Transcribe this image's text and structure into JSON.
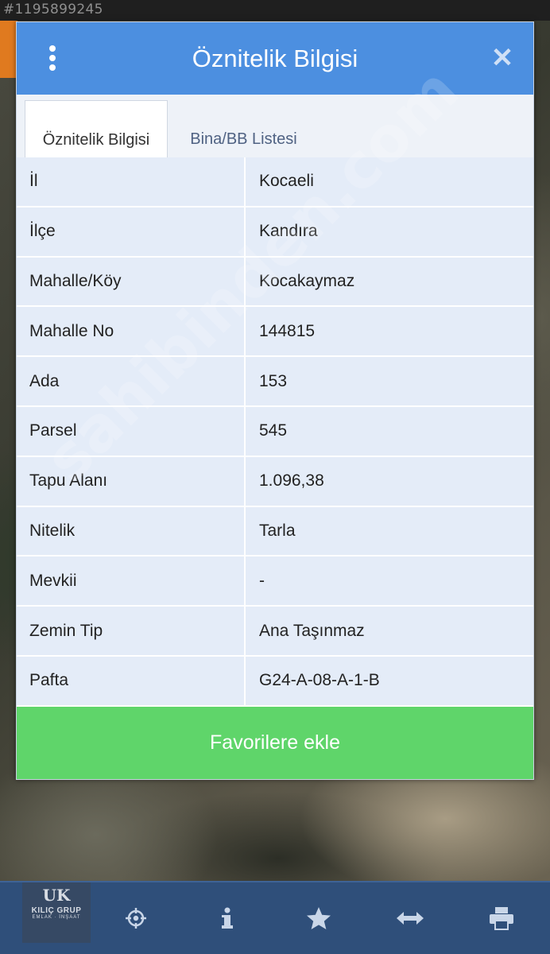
{
  "listing_id": "#1195899245",
  "dialog": {
    "title": "Öznitelik Bilgisi",
    "menu_icon": "more-vertical-icon",
    "close_icon": "close-icon"
  },
  "tabs": [
    {
      "label": "Öznitelik Bilgisi",
      "active": true
    },
    {
      "label": "Bina/BB Listesi",
      "active": false
    }
  ],
  "rows": [
    {
      "label": "İl",
      "value": "Kocaeli"
    },
    {
      "label": "İlçe",
      "value": "Kandıra"
    },
    {
      "label": "Mahalle/Köy",
      "value": "Kocakaymaz"
    },
    {
      "label": "Mahalle No",
      "value": "144815"
    },
    {
      "label": "Ada",
      "value": "153"
    },
    {
      "label": "Parsel",
      "value": "545"
    },
    {
      "label": "Tapu Alanı",
      "value": "1.096,38"
    },
    {
      "label": "Nitelik",
      "value": "Tarla"
    },
    {
      "label": "Mevkii",
      "value": "-"
    },
    {
      "label": "Zemin Tip",
      "value": "Ana Taşınmaz"
    },
    {
      "label": "Pafta",
      "value": "G24-A-08-A-1-B"
    }
  ],
  "favorite_button": "Favorilere ekle",
  "watermark": "sahibinden.com",
  "logo": {
    "mark": "UK",
    "name": "KILIÇ GRUP",
    "sub": "EMLAK · İNŞAAT"
  },
  "toolbar": {
    "icons": [
      "crosshair-icon",
      "info-icon",
      "star-icon",
      "horizontal-arrows-icon",
      "printer-icon"
    ]
  },
  "colors": {
    "header": "#4c8fe0",
    "row_bg": "#e4ecf8",
    "favorite_button": "#5fd56a",
    "toolbar": "#2f4f7a"
  }
}
